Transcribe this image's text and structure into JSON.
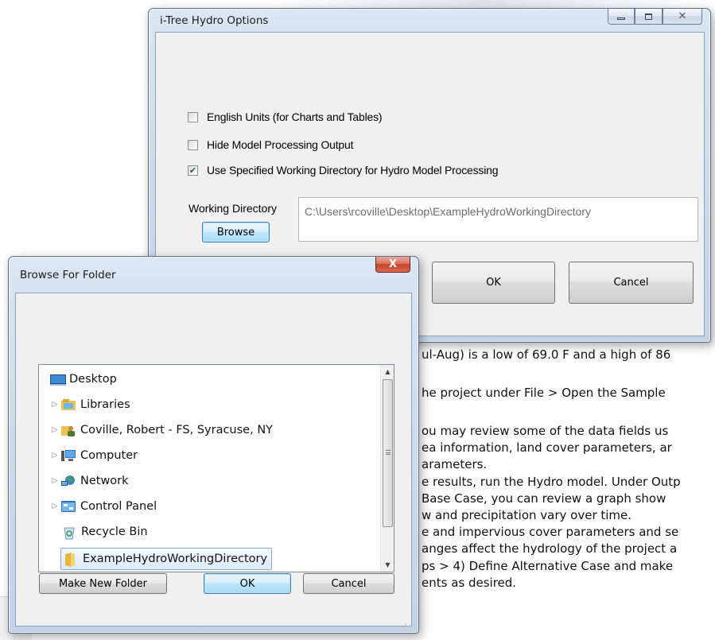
{
  "background_doc": {
    "lines": [
      "ul-Aug) is a low of 69.0 F and a high of 86",
      "he project under File > Open the Sample",
      "ou may review some of the data fields us",
      "ea information, land cover parameters, ar",
      "arameters.",
      "e results, run the Hydro model. Under Outp",
      "Base Case, you can review a graph show",
      "w and precipitation vary over time.",
      "e and impervious cover parameters and se",
      "anges affect the hydrology of the project a",
      "ps > 4) Define Alternative Case and make",
      "ents as desired."
    ]
  },
  "options_window": {
    "title": "i-Tree Hydro Options",
    "caption": {
      "minimize": "▭",
      "maximize": "▣",
      "close": "✕"
    },
    "checkboxes": [
      {
        "label": "English Units (for Charts and Tables)",
        "checked": false
      },
      {
        "label": "Hide Model Processing Output",
        "checked": false
      },
      {
        "label": "Use Specified Working Directory for Hydro Model Processing",
        "checked": true
      }
    ],
    "working_directory_label": "Working Directory",
    "working_directory_value": "C:\\Users\\rcoville\\Desktop\\ExampleHydroWorkingDirectory",
    "browse_label": "Browse",
    "ok_label": "OK",
    "cancel_label": "Cancel"
  },
  "browse_dialog": {
    "title": "Browse For Folder",
    "close_glyph": "X",
    "tree": [
      {
        "label": "Desktop",
        "icon": "desktop-icon",
        "expander": ""
      },
      {
        "label": "Libraries",
        "icon": "libraries-icon",
        "expander": "▷"
      },
      {
        "label": "Coville, Robert - FS, Syracuse, NY",
        "icon": "user-folder-icon",
        "expander": "▷"
      },
      {
        "label": "Computer",
        "icon": "computer-icon",
        "expander": "▷"
      },
      {
        "label": "Network",
        "icon": "network-icon",
        "expander": "▷"
      },
      {
        "label": "Control Panel",
        "icon": "control-panel-icon",
        "expander": "▷"
      },
      {
        "label": "Recycle Bin",
        "icon": "recycle-bin-icon",
        "expander": ""
      },
      {
        "label": "ExampleHydroWorkingDirectory",
        "icon": "folder-icon",
        "expander": "",
        "selected": true
      }
    ],
    "make_new_folder_label": "Make New Folder",
    "ok_label": "OK",
    "cancel_label": "Cancel"
  }
}
